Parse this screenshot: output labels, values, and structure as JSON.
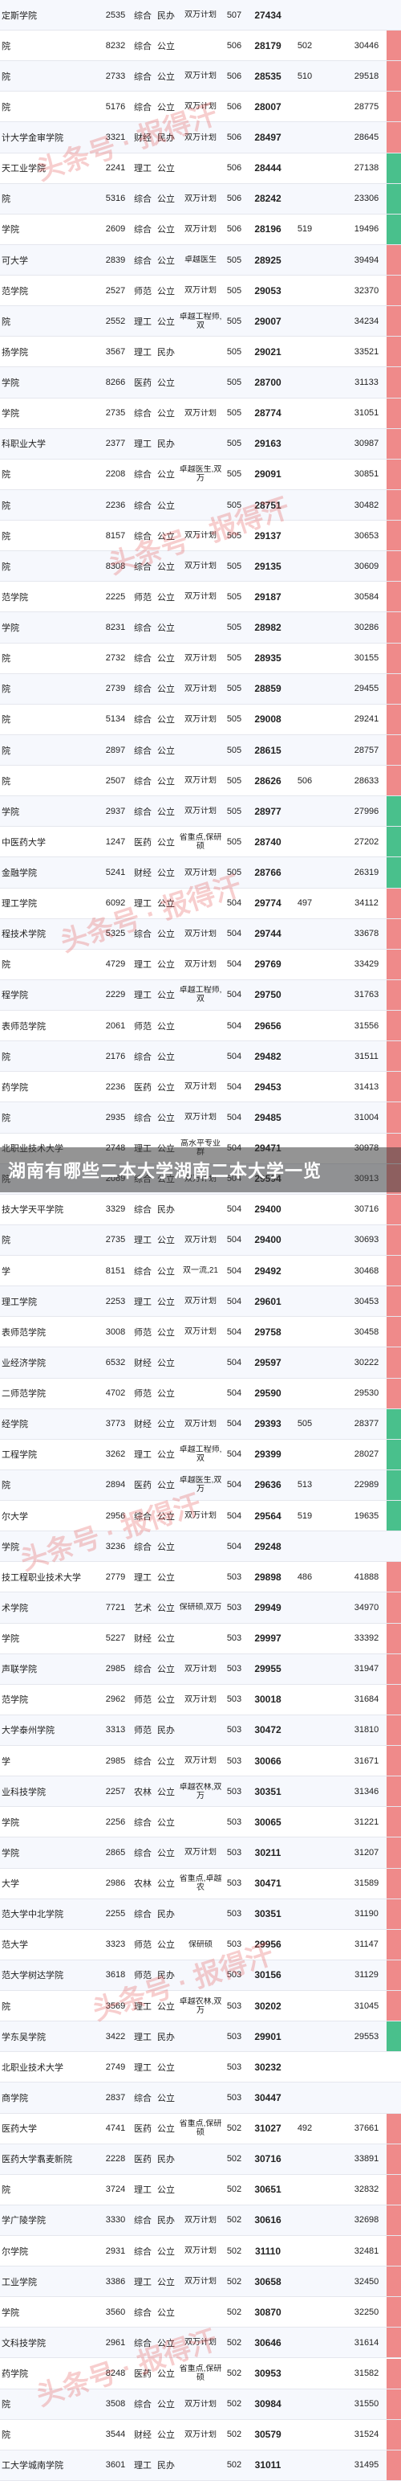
{
  "banner": "湖南有哪些二本大学湖南二本大学一览",
  "watermark": "头条号 · 报得汗",
  "rows": [
    {
      "name": "定斯学院",
      "code": "2535",
      "type": "综合",
      "nature": "民办",
      "tag": "双万计划",
      "score": "507",
      "rank": "27434",
      "s2": "",
      "s3": "",
      "r2": "",
      "flag": ""
    },
    {
      "name": "院",
      "code": "8232",
      "type": "综合",
      "nature": "公立",
      "tag": "",
      "score": "506",
      "rank": "28179",
      "s2": "502",
      "s3": "",
      "r2": "30446",
      "flag": "red"
    },
    {
      "name": "院",
      "code": "2733",
      "type": "综合",
      "nature": "公立",
      "tag": "双万计划",
      "score": "506",
      "rank": "28535",
      "s2": "510",
      "s3": "",
      "r2": "29518",
      "flag": "red"
    },
    {
      "name": "院",
      "code": "5176",
      "type": "综合",
      "nature": "公立",
      "tag": "双万计划",
      "score": "506",
      "rank": "28007",
      "s2": "",
      "s3": "",
      "r2": "28775",
      "flag": "red"
    },
    {
      "name": "计大学金审学院",
      "code": "3321",
      "type": "财经",
      "nature": "民办",
      "tag": "双万计划",
      "score": "506",
      "rank": "28497",
      "s2": "",
      "s3": "",
      "r2": "28645",
      "flag": "red"
    },
    {
      "name": "天工业学院",
      "code": "2241",
      "type": "理工",
      "nature": "公立",
      "tag": "",
      "score": "506",
      "rank": "28444",
      "s2": "",
      "s3": "",
      "r2": "27138",
      "flag": "green"
    },
    {
      "name": "院",
      "code": "5316",
      "type": "综合",
      "nature": "公立",
      "tag": "双万计划",
      "score": "506",
      "rank": "28242",
      "s2": "",
      "s3": "",
      "r2": "23306",
      "flag": "green"
    },
    {
      "name": "学院",
      "code": "2609",
      "type": "综合",
      "nature": "公立",
      "tag": "双万计划",
      "score": "506",
      "rank": "28196",
      "s2": "519",
      "s3": "",
      "r2": "19496",
      "flag": "green"
    },
    {
      "name": "可大学",
      "code": "2839",
      "type": "综合",
      "nature": "公立",
      "tag": "卓越医生",
      "score": "505",
      "rank": "28925",
      "s2": "",
      "s3": "",
      "r2": "39494",
      "flag": "red"
    },
    {
      "name": "范学院",
      "code": "2527",
      "type": "师范",
      "nature": "公立",
      "tag": "双万计划",
      "score": "505",
      "rank": "29053",
      "s2": "",
      "s3": "",
      "r2": "32370",
      "flag": "red"
    },
    {
      "name": "院",
      "code": "2552",
      "type": "理工",
      "nature": "公立",
      "tag": "卓越工程师,双",
      "score": "505",
      "rank": "29007",
      "s2": "",
      "s3": "",
      "r2": "34234",
      "flag": "red"
    },
    {
      "name": "扬学院",
      "code": "3567",
      "type": "理工",
      "nature": "民办",
      "tag": "",
      "score": "505",
      "rank": "29021",
      "s2": "",
      "s3": "",
      "r2": "33521",
      "flag": "red"
    },
    {
      "name": "学院",
      "code": "8266",
      "type": "医药",
      "nature": "公立",
      "tag": "",
      "score": "505",
      "rank": "28700",
      "s2": "",
      "s3": "",
      "r2": "31133",
      "flag": "red"
    },
    {
      "name": "学院",
      "code": "2735",
      "type": "综合",
      "nature": "公立",
      "tag": "双万计划",
      "score": "505",
      "rank": "28774",
      "s2": "",
      "s3": "",
      "r2": "31051",
      "flag": "red"
    },
    {
      "name": "科职业大学",
      "code": "2377",
      "type": "理工",
      "nature": "民办",
      "tag": "",
      "score": "505",
      "rank": "29163",
      "s2": "",
      "s3": "",
      "r2": "30987",
      "flag": "red"
    },
    {
      "name": "院",
      "code": "2208",
      "type": "综合",
      "nature": "公立",
      "tag": "卓越医生,双万",
      "score": "505",
      "rank": "29091",
      "s2": "",
      "s3": "",
      "r2": "30851",
      "flag": "red"
    },
    {
      "name": "院",
      "code": "2236",
      "type": "综合",
      "nature": "公立",
      "tag": "",
      "score": "505",
      "rank": "28751",
      "s2": "",
      "s3": "",
      "r2": "30482",
      "flag": "red"
    },
    {
      "name": "院",
      "code": "8157",
      "type": "综合",
      "nature": "公立",
      "tag": "双万计划",
      "score": "505",
      "rank": "29137",
      "s2": "",
      "s3": "",
      "r2": "30653",
      "flag": "red"
    },
    {
      "name": "院",
      "code": "8308",
      "type": "综合",
      "nature": "公立",
      "tag": "双万计划",
      "score": "505",
      "rank": "29135",
      "s2": "",
      "s3": "",
      "r2": "30609",
      "flag": "red"
    },
    {
      "name": "范学院",
      "code": "2225",
      "type": "师范",
      "nature": "公立",
      "tag": "双万计划",
      "score": "505",
      "rank": "29187",
      "s2": "",
      "s3": "",
      "r2": "30584",
      "flag": "red"
    },
    {
      "name": "学院",
      "code": "8231",
      "type": "综合",
      "nature": "公立",
      "tag": "",
      "score": "505",
      "rank": "28982",
      "s2": "",
      "s3": "",
      "r2": "30286",
      "flag": "red"
    },
    {
      "name": "院",
      "code": "2732",
      "type": "综合",
      "nature": "公立",
      "tag": "双万计划",
      "score": "505",
      "rank": "28935",
      "s2": "",
      "s3": "",
      "r2": "30155",
      "flag": "red"
    },
    {
      "name": "院",
      "code": "2739",
      "type": "综合",
      "nature": "公立",
      "tag": "双万计划",
      "score": "505",
      "rank": "28859",
      "s2": "",
      "s3": "",
      "r2": "29455",
      "flag": "red"
    },
    {
      "name": "院",
      "code": "5134",
      "type": "综合",
      "nature": "公立",
      "tag": "双万计划",
      "score": "505",
      "rank": "29008",
      "s2": "",
      "s3": "",
      "r2": "29241",
      "flag": "red"
    },
    {
      "name": "院",
      "code": "2897",
      "type": "综合",
      "nature": "公立",
      "tag": "",
      "score": "505",
      "rank": "28615",
      "s2": "",
      "s3": "",
      "r2": "28757",
      "flag": "red"
    },
    {
      "name": "院",
      "code": "2507",
      "type": "综合",
      "nature": "公立",
      "tag": "双万计划",
      "score": "505",
      "rank": "28626",
      "s2": "506",
      "s3": "",
      "r2": "28633",
      "flag": "red"
    },
    {
      "name": "学院",
      "code": "2937",
      "type": "综合",
      "nature": "公立",
      "tag": "双万计划",
      "score": "505",
      "rank": "28977",
      "s2": "",
      "s3": "",
      "r2": "27996",
      "flag": "green"
    },
    {
      "name": "中医药大学",
      "code": "1247",
      "type": "医药",
      "nature": "公立",
      "tag": "省重点,保研硕",
      "score": "505",
      "rank": "28740",
      "s2": "",
      "s3": "",
      "r2": "27202",
      "flag": "green"
    },
    {
      "name": "金融学院",
      "code": "5241",
      "type": "财经",
      "nature": "公立",
      "tag": "双万计划",
      "score": "505",
      "rank": "28766",
      "s2": "",
      "s3": "",
      "r2": "26319",
      "flag": "green"
    },
    {
      "name": "理工学院",
      "code": "6092",
      "type": "理工",
      "nature": "公立",
      "tag": "",
      "score": "504",
      "rank": "29774",
      "s2": "497",
      "s3": "",
      "r2": "34112",
      "flag": "red"
    },
    {
      "name": "程技术学院",
      "code": "5325",
      "type": "综合",
      "nature": "公立",
      "tag": "双万计划",
      "score": "504",
      "rank": "29744",
      "s2": "",
      "s3": "",
      "r2": "33678",
      "flag": "red"
    },
    {
      "name": "院",
      "code": "4729",
      "type": "理工",
      "nature": "公立",
      "tag": "双万计划",
      "score": "504",
      "rank": "29769",
      "s2": "",
      "s3": "",
      "r2": "33429",
      "flag": "red"
    },
    {
      "name": "程学院",
      "code": "2229",
      "type": "理工",
      "nature": "公立",
      "tag": "卓越工程师,双",
      "score": "504",
      "rank": "29750",
      "s2": "",
      "s3": "",
      "r2": "31763",
      "flag": "red"
    },
    {
      "name": "表师范学院",
      "code": "2061",
      "type": "师范",
      "nature": "公立",
      "tag": "",
      "score": "504",
      "rank": "29656",
      "s2": "",
      "s3": "",
      "r2": "31556",
      "flag": "red"
    },
    {
      "name": "院",
      "code": "2176",
      "type": "综合",
      "nature": "公立",
      "tag": "",
      "score": "504",
      "rank": "29482",
      "s2": "",
      "s3": "",
      "r2": "31511",
      "flag": "red"
    },
    {
      "name": "药学院",
      "code": "2236",
      "type": "医药",
      "nature": "公立",
      "tag": "双万计划",
      "score": "504",
      "rank": "29453",
      "s2": "",
      "s3": "",
      "r2": "31413",
      "flag": "red"
    },
    {
      "name": "院",
      "code": "2935",
      "type": "综合",
      "nature": "公立",
      "tag": "双万计划",
      "score": "504",
      "rank": "29485",
      "s2": "",
      "s3": "",
      "r2": "31004",
      "flag": "red"
    },
    {
      "name": "北职业技术大学",
      "code": "2748",
      "type": "理工",
      "nature": "公立",
      "tag": "高水平专业群",
      "score": "504",
      "rank": "29471",
      "s2": "",
      "s3": "",
      "r2": "30978",
      "flag": "red"
    },
    {
      "name": "院",
      "code": "2089",
      "type": "综合",
      "nature": "公立",
      "tag": "双万计划",
      "score": "504",
      "rank": "29594",
      "s2": "",
      "s3": "",
      "r2": "30913",
      "flag": "red"
    },
    {
      "name": "技大学天平学院",
      "code": "3329",
      "type": "综合",
      "nature": "民办",
      "tag": "",
      "score": "504",
      "rank": "29400",
      "s2": "",
      "s3": "",
      "r2": "30716",
      "flag": "red"
    },
    {
      "name": "院",
      "code": "2735",
      "type": "理工",
      "nature": "公立",
      "tag": "双万计划",
      "score": "504",
      "rank": "29400",
      "s2": "",
      "s3": "",
      "r2": "30693",
      "flag": "red"
    },
    {
      "name": "学",
      "code": "8151",
      "type": "综合",
      "nature": "公立",
      "tag": "双一流,21",
      "score": "504",
      "rank": "29492",
      "s2": "",
      "s3": "",
      "r2": "30468",
      "flag": "red"
    },
    {
      "name": "理工学院",
      "code": "2253",
      "type": "理工",
      "nature": "公立",
      "tag": "双万计划",
      "score": "504",
      "rank": "29601",
      "s2": "",
      "s3": "",
      "r2": "30453",
      "flag": "red"
    },
    {
      "name": "表师范学院",
      "code": "3008",
      "type": "师范",
      "nature": "公立",
      "tag": "双万计划",
      "score": "504",
      "rank": "29758",
      "s2": "",
      "s3": "",
      "r2": "30458",
      "flag": "red"
    },
    {
      "name": "业经济学院",
      "code": "6532",
      "type": "财经",
      "nature": "公立",
      "tag": "",
      "score": "504",
      "rank": "29597",
      "s2": "",
      "s3": "",
      "r2": "30222",
      "flag": "red"
    },
    {
      "name": "二师范学院",
      "code": "4702",
      "type": "师范",
      "nature": "公立",
      "tag": "",
      "score": "504",
      "rank": "29590",
      "s2": "",
      "s3": "",
      "r2": "29530",
      "flag": "red"
    },
    {
      "name": "经学院",
      "code": "3773",
      "type": "财经",
      "nature": "公立",
      "tag": "双万计划",
      "score": "504",
      "rank": "29393",
      "s2": "505",
      "s3": "",
      "r2": "28377",
      "flag": "green"
    },
    {
      "name": "工程学院",
      "code": "3262",
      "type": "理工",
      "nature": "公立",
      "tag": "卓越工程师,双",
      "score": "504",
      "rank": "29399",
      "s2": "",
      "s3": "",
      "r2": "28027",
      "flag": "green"
    },
    {
      "name": "院",
      "code": "2894",
      "type": "医药",
      "nature": "公立",
      "tag": "卓越医生,双万",
      "score": "504",
      "rank": "29636",
      "s2": "513",
      "s3": "",
      "r2": "22989",
      "flag": "green"
    },
    {
      "name": "尔大学",
      "code": "2956",
      "type": "综合",
      "nature": "公立",
      "tag": "双万计划",
      "score": "504",
      "rank": "29564",
      "s2": "519",
      "s3": "",
      "r2": "19635",
      "flag": "green"
    },
    {
      "name": "学院",
      "code": "3236",
      "type": "综合",
      "nature": "公立",
      "tag": "",
      "score": "504",
      "rank": "29248",
      "s2": "",
      "s3": "",
      "r2": "",
      "flag": ""
    },
    {
      "name": "技工程职业技术大学",
      "code": "2779",
      "type": "理工",
      "nature": "公立",
      "tag": "",
      "score": "503",
      "rank": "29898",
      "s2": "486",
      "s3": "",
      "r2": "41888",
      "flag": "red"
    },
    {
      "name": "术学院",
      "code": "7721",
      "type": "艺术",
      "nature": "公立",
      "tag": "保研硕,双万",
      "score": "503",
      "rank": "29949",
      "s2": "",
      "s3": "",
      "r2": "34970",
      "flag": "red"
    },
    {
      "name": "学院",
      "code": "5227",
      "type": "财经",
      "nature": "公立",
      "tag": "",
      "score": "503",
      "rank": "29997",
      "s2": "",
      "s3": "",
      "r2": "33392",
      "flag": "red"
    },
    {
      "name": "声联学院",
      "code": "2985",
      "type": "综合",
      "nature": "公立",
      "tag": "双万计划",
      "score": "503",
      "rank": "29955",
      "s2": "",
      "s3": "",
      "r2": "31947",
      "flag": "red"
    },
    {
      "name": "范学院",
      "code": "2962",
      "type": "师范",
      "nature": "公立",
      "tag": "双万计划",
      "score": "503",
      "rank": "30018",
      "s2": "",
      "s3": "",
      "r2": "31684",
      "flag": "red"
    },
    {
      "name": "大学泰州学院",
      "code": "3313",
      "type": "师范",
      "nature": "民办",
      "tag": "",
      "score": "503",
      "rank": "30472",
      "s2": "",
      "s3": "",
      "r2": "31810",
      "flag": "red"
    },
    {
      "name": "学",
      "code": "2985",
      "type": "综合",
      "nature": "公立",
      "tag": "双万计划",
      "score": "503",
      "rank": "30066",
      "s2": "",
      "s3": "",
      "r2": "31671",
      "flag": "red"
    },
    {
      "name": "业科技学院",
      "code": "2257",
      "type": "农林",
      "nature": "公立",
      "tag": "卓越农林,双万",
      "score": "503",
      "rank": "30351",
      "s2": "",
      "s3": "",
      "r2": "31346",
      "flag": "red"
    },
    {
      "name": "学院",
      "code": "2256",
      "type": "综合",
      "nature": "公立",
      "tag": "",
      "score": "503",
      "rank": "30065",
      "s2": "",
      "s3": "",
      "r2": "31221",
      "flag": "red"
    },
    {
      "name": "学院",
      "code": "2865",
      "type": "综合",
      "nature": "公立",
      "tag": "双万计划",
      "score": "503",
      "rank": "30211",
      "s2": "",
      "s3": "",
      "r2": "31207",
      "flag": "red"
    },
    {
      "name": "大学",
      "code": "2986",
      "type": "农林",
      "nature": "公立",
      "tag": "省重点,卓越农",
      "score": "503",
      "rank": "30471",
      "s2": "",
      "s3": "",
      "r2": "31589",
      "flag": "red"
    },
    {
      "name": "范大学中北学院",
      "code": "2255",
      "type": "综合",
      "nature": "民办",
      "tag": "",
      "score": "503",
      "rank": "30351",
      "s2": "",
      "s3": "",
      "r2": "31190",
      "flag": "red"
    },
    {
      "name": "范大学",
      "code": "3323",
      "type": "师范",
      "nature": "公立",
      "tag": "保研硕",
      "score": "503",
      "rank": "29956",
      "s2": "",
      "s3": "",
      "r2": "31147",
      "flag": "red"
    },
    {
      "name": "范大学树达学院",
      "code": "3618",
      "type": "师范",
      "nature": "民办",
      "tag": "",
      "score": "503",
      "rank": "30156",
      "s2": "",
      "s3": "",
      "r2": "31129",
      "flag": "red"
    },
    {
      "name": "院",
      "code": "3569",
      "type": "理工",
      "nature": "公立",
      "tag": "卓越农林,双万",
      "score": "503",
      "rank": "30202",
      "s2": "",
      "s3": "",
      "r2": "31045",
      "flag": "red"
    },
    {
      "name": "学东吴学院",
      "code": "3422",
      "type": "理工",
      "nature": "民办",
      "tag": "",
      "score": "503",
      "rank": "29901",
      "s2": "",
      "s3": "",
      "r2": "29553",
      "flag": "green"
    },
    {
      "name": "北职业技术大学",
      "code": "2749",
      "type": "理工",
      "nature": "公立",
      "tag": "",
      "score": "503",
      "rank": "30232",
      "s2": "",
      "s3": "",
      "r2": "",
      "flag": ""
    },
    {
      "name": "商学院",
      "code": "2837",
      "type": "综合",
      "nature": "公立",
      "tag": "",
      "score": "503",
      "rank": "30447",
      "s2": "",
      "s3": "",
      "r2": "",
      "flag": ""
    },
    {
      "name": "医药大学",
      "code": "4741",
      "type": "医药",
      "nature": "公立",
      "tag": "省重点,保研硕",
      "score": "502",
      "rank": "31027",
      "s2": "492",
      "s3": "",
      "r2": "37661",
      "flag": "red"
    },
    {
      "name": "医药大学翥麦新院",
      "code": "2228",
      "type": "医药",
      "nature": "民办",
      "tag": "",
      "score": "502",
      "rank": "30716",
      "s2": "",
      "s3": "",
      "r2": "33891",
      "flag": "red"
    },
    {
      "name": "院",
      "code": "3724",
      "type": "理工",
      "nature": "公立",
      "tag": "",
      "score": "502",
      "rank": "30651",
      "s2": "",
      "s3": "",
      "r2": "32832",
      "flag": "red"
    },
    {
      "name": "学广陵学院",
      "code": "3330",
      "type": "综合",
      "nature": "民办",
      "tag": "双万计划",
      "score": "502",
      "rank": "30616",
      "s2": "",
      "s3": "",
      "r2": "32698",
      "flag": "red"
    },
    {
      "name": "尔学院",
      "code": "2931",
      "type": "综合",
      "nature": "公立",
      "tag": "双万计划",
      "score": "502",
      "rank": "31110",
      "s2": "",
      "s3": "",
      "r2": "32481",
      "flag": "red"
    },
    {
      "name": "工业学院",
      "code": "3386",
      "type": "理工",
      "nature": "公立",
      "tag": "双万计划",
      "score": "502",
      "rank": "30658",
      "s2": "",
      "s3": "",
      "r2": "32450",
      "flag": "red"
    },
    {
      "name": "学院",
      "code": "3560",
      "type": "综合",
      "nature": "公立",
      "tag": "",
      "score": "502",
      "rank": "30870",
      "s2": "",
      "s3": "",
      "r2": "32250",
      "flag": "red"
    },
    {
      "name": "文科技学院",
      "code": "2961",
      "type": "综合",
      "nature": "公立",
      "tag": "双万计划",
      "score": "502",
      "rank": "30646",
      "s2": "",
      "s3": "",
      "r2": "31614",
      "flag": "red"
    },
    {
      "name": "药学院",
      "code": "8248",
      "type": "医药",
      "nature": "公立",
      "tag": "省重点,保研硕",
      "score": "502",
      "rank": "30953",
      "s2": "",
      "s3": "",
      "r2": "31582",
      "flag": "red"
    },
    {
      "name": "院",
      "code": "3508",
      "type": "综合",
      "nature": "公立",
      "tag": "双万计划",
      "score": "502",
      "rank": "30984",
      "s2": "",
      "s3": "",
      "r2": "31550",
      "flag": "red"
    },
    {
      "name": "院",
      "code": "3544",
      "type": "财经",
      "nature": "公立",
      "tag": "双万计划",
      "score": "502",
      "rank": "30579",
      "s2": "",
      "s3": "",
      "r2": "31524",
      "flag": "red"
    },
    {
      "name": "工大学城南学院",
      "code": "3601",
      "type": "理工",
      "nature": "民办",
      "tag": "",
      "score": "502",
      "rank": "31011",
      "s2": "",
      "s3": "",
      "r2": "31495",
      "flag": "red"
    }
  ]
}
